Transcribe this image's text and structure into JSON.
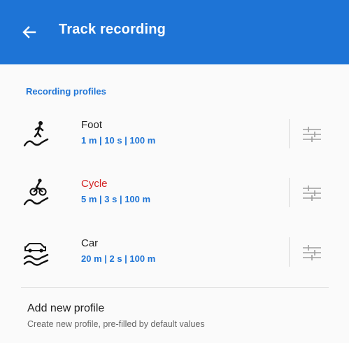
{
  "colors": {
    "app_bar": "#1e74d6",
    "accent": "#1e74d6",
    "active_profile": "#d32222",
    "text_primary": "#222222",
    "text_secondary": "#666666"
  },
  "header": {
    "back_icon": "arrow-left-icon",
    "title": "Track recording"
  },
  "section": {
    "title": "Recording profiles"
  },
  "profiles": [
    {
      "name": "Foot",
      "settings": "1 m | 10 s | 100 m",
      "icon": "walking-track-icon",
      "active": false
    },
    {
      "name": "Cycle",
      "settings": "5 m | 3 s | 100 m",
      "icon": "cycling-track-icon",
      "active": true
    },
    {
      "name": "Car",
      "settings": "20 m | 2 s | 100 m",
      "icon": "car-track-icon",
      "active": false
    }
  ],
  "profile_settings_icon": "sliders-icon",
  "add_profile": {
    "title": "Add new profile",
    "description": "Create new profile, pre-filled by default values"
  }
}
